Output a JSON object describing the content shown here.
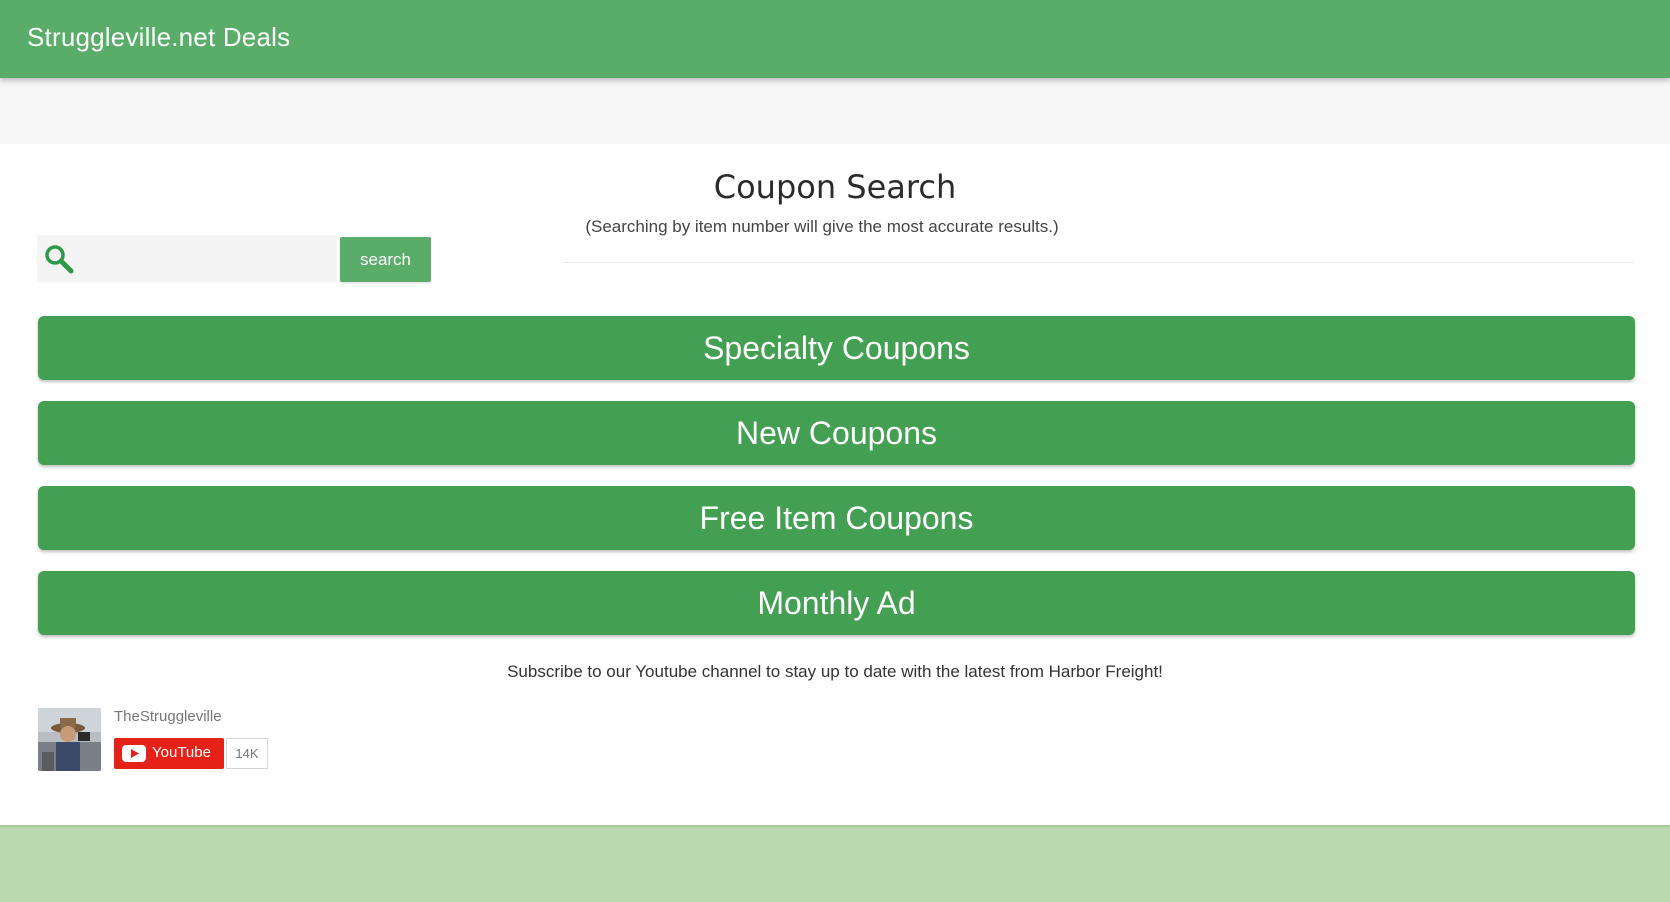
{
  "header": {
    "title": "Struggleville.net Deals"
  },
  "search": {
    "placeholder": "",
    "value": "",
    "button_label": "search"
  },
  "coupon_search": {
    "title": "Coupon Search",
    "subtitle": "(Searching by item number will give the most accurate results.)"
  },
  "nav_buttons": [
    {
      "label": "Specialty Coupons"
    },
    {
      "label": "New Coupons"
    },
    {
      "label": "Free Item Coupons"
    },
    {
      "label": "Monthly Ad"
    }
  ],
  "subscribe": {
    "text": "Subscribe to our Youtube channel to stay up to date with the latest from Harbor Freight!",
    "channel_name": "TheStruggleville",
    "youtube_label": "YouTube",
    "subscriber_count": "14K"
  },
  "colors": {
    "app_bar": "#5aad68",
    "button_green": "#43a053",
    "footer": "#b9d8b0",
    "youtube_red": "#e62117"
  },
  "icons": {
    "search": "search-icon",
    "youtube": "youtube-play-icon"
  }
}
